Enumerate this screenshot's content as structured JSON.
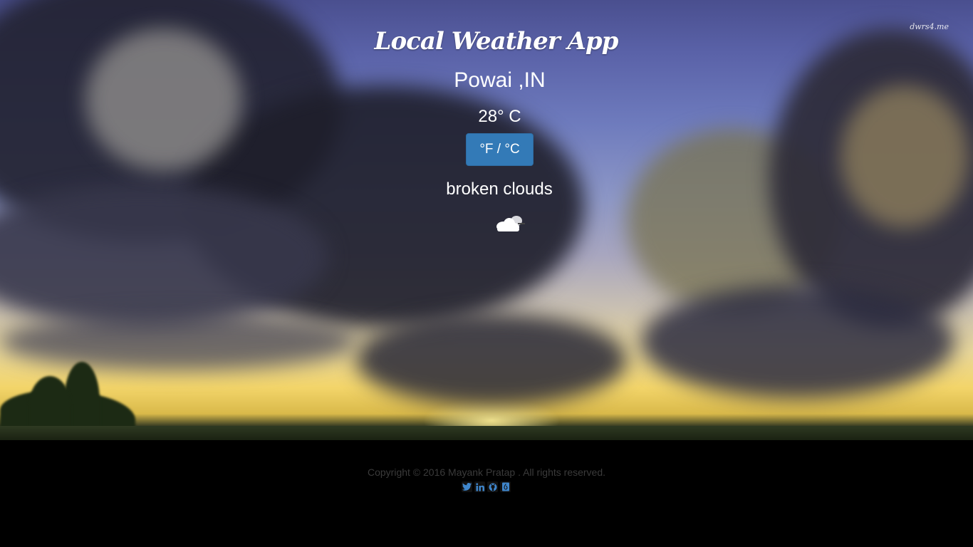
{
  "watermark": "dwrs4.me",
  "app": {
    "title": "Local Weather App",
    "location": "Powai ,IN",
    "temperature": "28° C",
    "unit_toggle_label": "°F / °C",
    "condition": "broken clouds",
    "condition_icon": "broken-clouds-icon"
  },
  "footer": {
    "copyright": "Copyright © 2016 Mayank Pratap . All rights reserved.",
    "socials": [
      {
        "name": "twitter-icon",
        "glyph": "t"
      },
      {
        "name": "linkedin-icon",
        "glyph": "in"
      },
      {
        "name": "github-icon",
        "glyph": "gh"
      },
      {
        "name": "codepen-icon",
        "glyph": "cp"
      }
    ]
  },
  "colors": {
    "button": "#337ab7",
    "footer_bg": "#000000",
    "footer_text": "#3a3a3a",
    "social": "#3f86cc"
  }
}
